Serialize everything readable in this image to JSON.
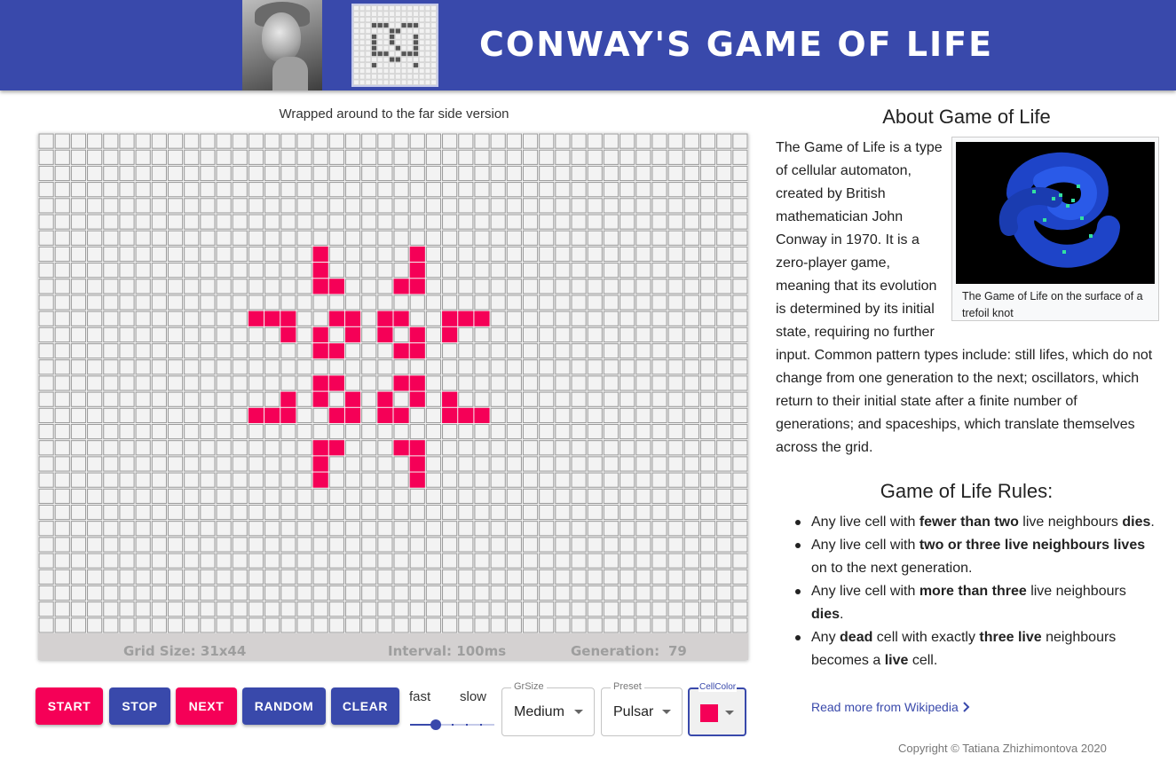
{
  "header": {
    "title": "CONWAY'S GAME OF LIFE",
    "portrait_alt": "portrait"
  },
  "board": {
    "version_label": "Wrapped around to the far side version",
    "rows": 31,
    "cols": 44,
    "live_color": "#f50057",
    "live_cells": [
      [
        7,
        17
      ],
      [
        7,
        23
      ],
      [
        8,
        17
      ],
      [
        8,
        23
      ],
      [
        9,
        17
      ],
      [
        9,
        18
      ],
      [
        9,
        22
      ],
      [
        9,
        23
      ],
      [
        11,
        13
      ],
      [
        11,
        14
      ],
      [
        11,
        15
      ],
      [
        11,
        18
      ],
      [
        11,
        19
      ],
      [
        11,
        21
      ],
      [
        11,
        22
      ],
      [
        11,
        25
      ],
      [
        11,
        26
      ],
      [
        11,
        27
      ],
      [
        12,
        15
      ],
      [
        12,
        17
      ],
      [
        12,
        19
      ],
      [
        12,
        21
      ],
      [
        12,
        23
      ],
      [
        12,
        25
      ],
      [
        13,
        17
      ],
      [
        13,
        18
      ],
      [
        13,
        22
      ],
      [
        13,
        23
      ],
      [
        15,
        17
      ],
      [
        15,
        18
      ],
      [
        15,
        22
      ],
      [
        15,
        23
      ],
      [
        16,
        15
      ],
      [
        16,
        17
      ],
      [
        16,
        19
      ],
      [
        16,
        21
      ],
      [
        16,
        23
      ],
      [
        16,
        25
      ],
      [
        17,
        13
      ],
      [
        17,
        14
      ],
      [
        17,
        15
      ],
      [
        17,
        18
      ],
      [
        17,
        19
      ],
      [
        17,
        21
      ],
      [
        17,
        22
      ],
      [
        17,
        25
      ],
      [
        17,
        26
      ],
      [
        17,
        27
      ],
      [
        19,
        17
      ],
      [
        19,
        18
      ],
      [
        19,
        22
      ],
      [
        19,
        23
      ],
      [
        20,
        17
      ],
      [
        20,
        23
      ],
      [
        21,
        17
      ],
      [
        21,
        23
      ]
    ],
    "status": {
      "grid_size": "Grid Size: 31x44",
      "interval": "Interval: 100ms",
      "generation_label": "Generation:",
      "generation_value": "79"
    }
  },
  "controls": {
    "start": "START",
    "stop": "STOP",
    "next": "NEXT",
    "random": "RANDOM",
    "clear": "CLEAR",
    "speed_fast": "fast",
    "speed_slow": "slow",
    "speed_level": 0.3,
    "grid_size_select": {
      "label": "GrSize",
      "value": "Medium"
    },
    "preset_select": {
      "label": "Preset",
      "value": "Pulsar"
    },
    "cell_color_select": {
      "label": "CellColor",
      "value": "#f50057"
    }
  },
  "about": {
    "title": "About Game of Life",
    "text": "The Game of Life is a type of cellular automaton, created by British mathematician John Conway in 1970. It is a zero-player game, meaning that its evolution is determined by its initial state, requiring no further input. Common pattern types include: still lifes, which do not change from one generation to the next; oscillators, which return to their initial state after a finite number of generations; and spaceships, which translate themselves across the grid.",
    "figure_caption": "The Game of Life on the surface of a trefoil knot"
  },
  "rules": {
    "title": "Game of Life Rules:",
    "items": [
      {
        "a": "Any live cell with ",
        "b": "fewer than two",
        "c": " live neighbours ",
        "d": "dies",
        "e": "."
      },
      {
        "a": "Any live cell with ",
        "b": "two or three live neighbours",
        "c": " ",
        "d": "lives",
        "e": " on to the next generation."
      },
      {
        "a": "Any live cell with ",
        "b": "more than three",
        "c": " live neighbours ",
        "d": "dies",
        "e": "."
      }
    ],
    "last": {
      "a": "Any ",
      "b": "dead",
      "c": " cell with exactly ",
      "d": "three live",
      "e": " neighbours becomes a ",
      "f": "live",
      "g": " cell."
    },
    "wiki_link": "Read more from Wikipedia",
    "wiki_icon": "chevron-right-icon"
  },
  "footer": {
    "copyright": "Copyright © Tatiana Zhizhimontova 2020"
  }
}
